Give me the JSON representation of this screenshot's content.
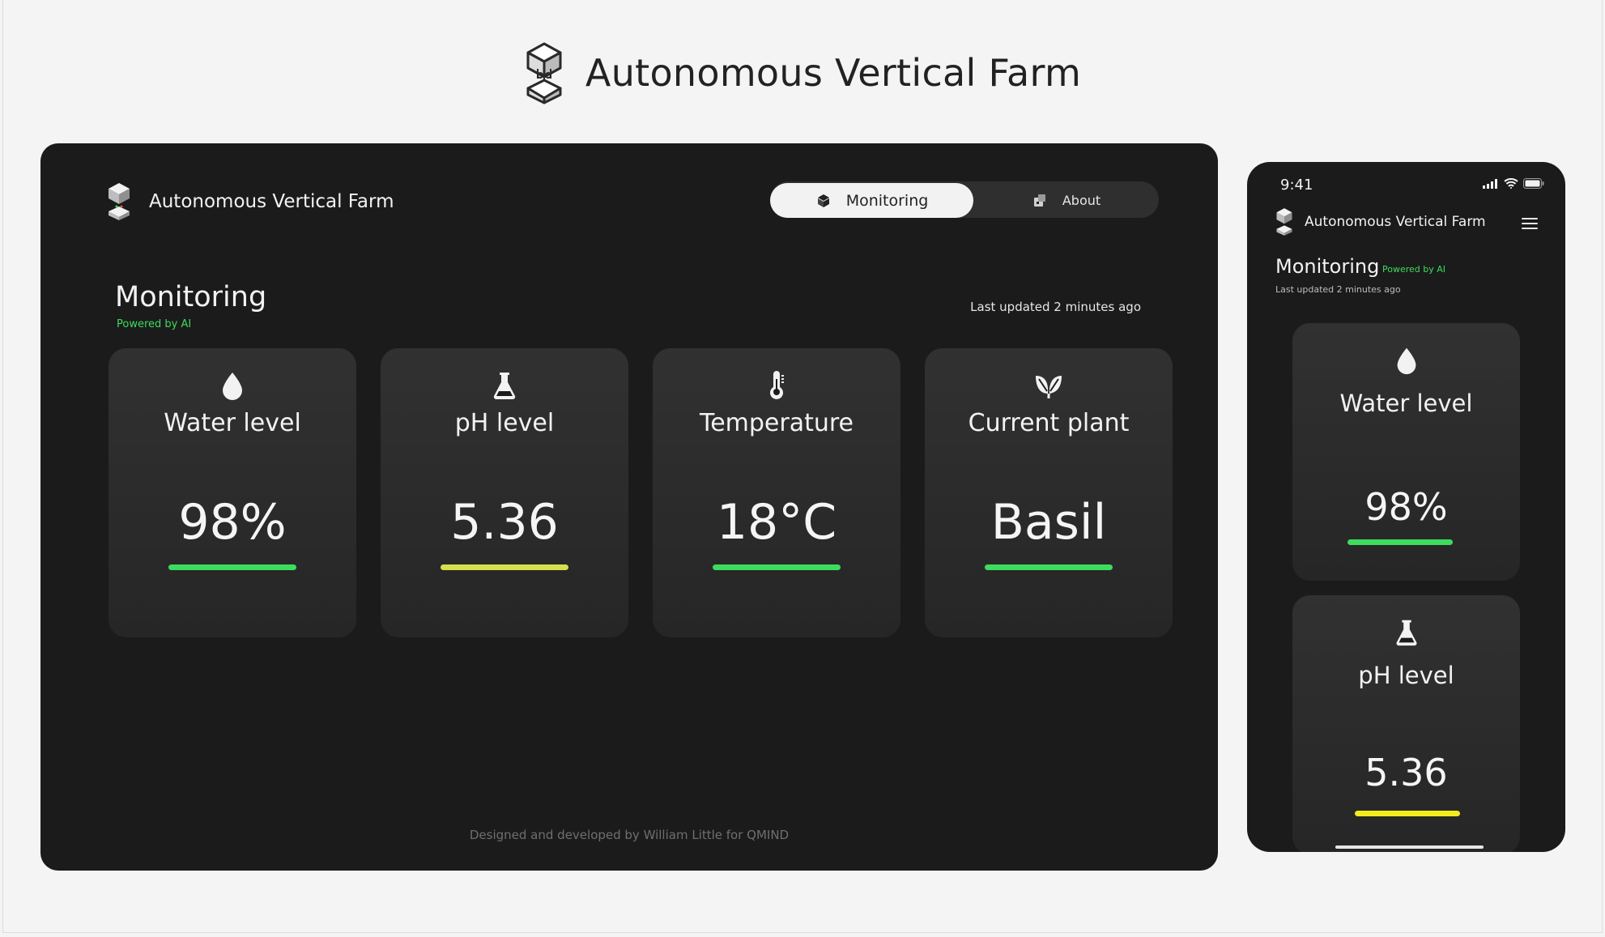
{
  "page": {
    "title": "Autonomous Vertical Farm"
  },
  "colors": {
    "green": "#3ddc5e",
    "yellow_green": "#d4e04d",
    "yellow": "#f4ec1e"
  },
  "desktop": {
    "brand": "Autonomous Vertical Farm",
    "nav": {
      "monitoring": "Monitoring",
      "about": "About"
    },
    "section": {
      "title": "Monitoring",
      "powered": "Powered by AI",
      "updated": "Last updated 2 minutes ago"
    },
    "cards": [
      {
        "label": "Water level",
        "value": "98%",
        "icon": "water-drop-icon",
        "status_color": "#3ddc5e"
      },
      {
        "label": "pH level",
        "value": "5.36",
        "icon": "flask-icon",
        "status_color": "#d4e04d"
      },
      {
        "label": "Temperature",
        "value": "18°C",
        "icon": "thermometer-icon",
        "status_color": "#3ddc5e"
      },
      {
        "label": "Current plant",
        "value": "Basil",
        "icon": "leaf-icon",
        "status_color": "#3ddc5e"
      }
    ],
    "footer": "Designed and developed by William Little for QMIND"
  },
  "mobile": {
    "time": "9:41",
    "brand": "Autonomous Vertical Farm",
    "section": {
      "title": "Monitoring",
      "powered": "Powered by AI",
      "updated": "Last updated 2 minutes ago"
    },
    "cards": [
      {
        "label": "Water level",
        "value": "98%",
        "icon": "water-drop-icon",
        "status_color": "#3ddc5e"
      },
      {
        "label": "pH level",
        "value": "5.36",
        "icon": "flask-icon",
        "status_color": "#f4ec1e"
      }
    ]
  }
}
